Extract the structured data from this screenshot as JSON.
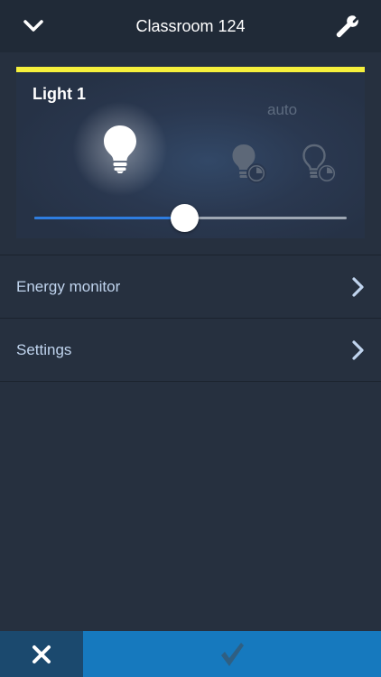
{
  "header": {
    "title": "Classroom 124",
    "back_icon": "chevron-down-icon",
    "settings_icon": "wrench-icon"
  },
  "light_panel": {
    "name": "Light 1",
    "auto_label": "auto",
    "accent_color": "#f6f03c",
    "brightness_percent": 48,
    "icons": [
      "lightbulb-on-icon",
      "lightbulb-auto-icon",
      "lightbulb-auto-outline-icon"
    ]
  },
  "menu": {
    "items": [
      {
        "label": "Energy monitor",
        "icon": "chevron-right-icon"
      },
      {
        "label": "Settings",
        "icon": "chevron-right-icon"
      }
    ]
  },
  "footer": {
    "cancel_icon": "close-icon",
    "confirm_icon": "checkmark-icon",
    "cancel_color": "#1b496e",
    "confirm_color": "#1679be"
  },
  "colors": {
    "background": "#26303f",
    "header": "#202a37",
    "slider_fill": "#2e7de0",
    "menu_text": "#c0d4ee"
  }
}
